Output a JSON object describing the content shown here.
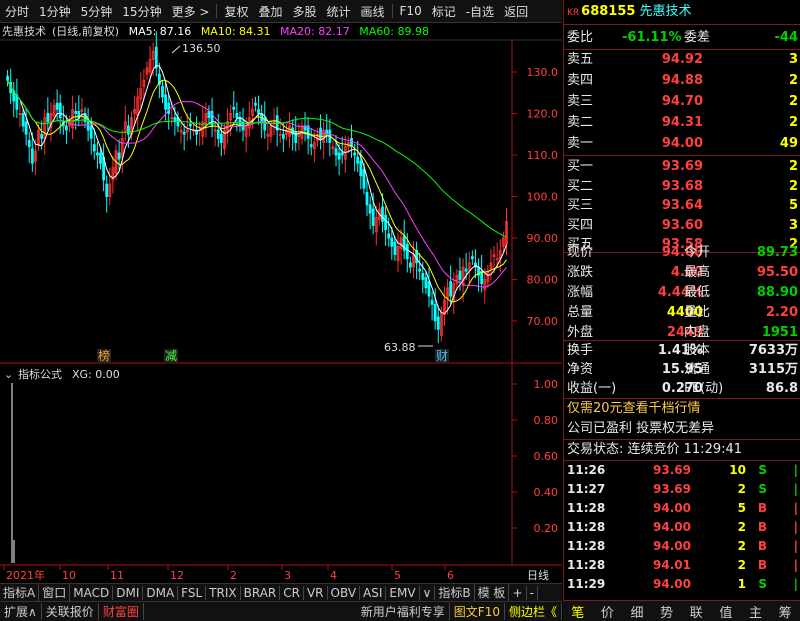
{
  "toolbar": {
    "items": [
      "分时",
      "1分钟",
      "5分钟",
      "15分钟",
      "更多 >",
      "复权",
      "叠加",
      "多股",
      "统计",
      "画线",
      "F10",
      "标记",
      "-自选",
      "返回"
    ]
  },
  "chart_header": {
    "name": "先惠技术",
    "mode": "(日线,前复权)",
    "ma5": "MA5: 87.16",
    "ma10": "MA10: 84.31",
    "ma20": "MA20: 82.17",
    "ma60": "MA60: 89.98"
  },
  "colors": {
    "ma5": "#ffffff",
    "ma10": "#ffff00",
    "ma20": "#ff40ff",
    "ma60": "#00ff00",
    "up": "#ff3030",
    "down": "#00ffff",
    "axis": "#b01010"
  },
  "price_axis": [
    "130.0",
    "120.0",
    "110.0",
    "100.0",
    "90.00",
    "80.00",
    "70.00"
  ],
  "annotations": {
    "high": "136.50",
    "low": "63.88",
    "tag_bang": "榜",
    "tag_jian": "减",
    "tag_cai": "财"
  },
  "indicator": {
    "title": "指标公式",
    "value": "XG: 0.00",
    "axis": [
      "1.00",
      "0.80",
      "0.60",
      "0.40",
      "0.20"
    ]
  },
  "date_axis": [
    "2021年",
    "10",
    "11",
    "12",
    "2",
    "3",
    "4",
    "5",
    "6"
  ],
  "period_label": "日线",
  "tabs_row1": [
    "指标A",
    "窗口",
    "MACD",
    "DMI",
    "DMA",
    "FSL",
    "TRIX",
    "BRAR",
    "CR",
    "VR",
    "OBV",
    "ASI",
    "EMV",
    "∨",
    "指标B",
    "模 板",
    "+",
    "-"
  ],
  "tabs_row2": {
    "left": [
      "扩展∧",
      "关联报价",
      "财富圈"
    ],
    "right": [
      "新用户福利专享",
      "图文F10",
      "侧边栏《"
    ]
  },
  "quote": {
    "code": "688155",
    "name": "先惠技术",
    "wei_bi_label": "委比",
    "wei_bi": "-61.11%",
    "wei_cha_label": "委差",
    "wei_cha": "-44",
    "asks": [
      {
        "label": "卖五",
        "price": "94.92",
        "vol": "3"
      },
      {
        "label": "卖四",
        "price": "94.88",
        "vol": "2"
      },
      {
        "label": "卖三",
        "price": "94.70",
        "vol": "2"
      },
      {
        "label": "卖二",
        "price": "94.31",
        "vol": "2"
      },
      {
        "label": "卖一",
        "price": "94.00",
        "vol": "49"
      }
    ],
    "bids": [
      {
        "label": "买一",
        "price": "93.69",
        "vol": "2"
      },
      {
        "label": "买二",
        "price": "93.68",
        "vol": "2"
      },
      {
        "label": "买三",
        "price": "93.64",
        "vol": "5"
      },
      {
        "label": "买四",
        "price": "93.60",
        "vol": "3"
      },
      {
        "label": "买五",
        "price": "93.58",
        "vol": "2"
      }
    ],
    "stats1": [
      {
        "l1": "现价",
        "v1": "94.00",
        "l2": "今开",
        "v2": "89.73"
      },
      {
        "l1": "涨跌",
        "v1": "4.00",
        "l2": "最高",
        "v2": "95.50"
      },
      {
        "l1": "涨幅",
        "v1": "4.44%",
        "l2": "最低",
        "v2": "88.90"
      },
      {
        "l1": "总量",
        "v1": "4400",
        "l2": "量比",
        "v2": "2.20"
      },
      {
        "l1": "外盘",
        "v1": "2449",
        "l2": "内盘",
        "v2": "1951"
      }
    ],
    "stats2": [
      {
        "l1": "换手",
        "v1": "1.41%",
        "l2": "股本",
        "v2": "7633万"
      },
      {
        "l1": "净资",
        "v1": "15.95",
        "l2": "流通",
        "v2": "3115万"
      },
      {
        "l1": "收益(一)",
        "v1": "0.270",
        "l2": "PE(动)",
        "v2": "86.8"
      }
    ],
    "promo": "仅需20元查看千档行情",
    "info": "公司已盈利 投票权无差异",
    "status": "交易状态: 连续竞价 11:29:41",
    "ticks": [
      {
        "time": "11:26",
        "price": "93.69",
        "vol": "10",
        "side": "S"
      },
      {
        "time": "11:27",
        "price": "93.69",
        "vol": "2",
        "side": "S"
      },
      {
        "time": "11:28",
        "price": "94.00",
        "vol": "5",
        "side": "B"
      },
      {
        "time": "11:28",
        "price": "94.00",
        "vol": "2",
        "side": "B"
      },
      {
        "time": "11:28",
        "price": "94.00",
        "vol": "2",
        "side": "B"
      },
      {
        "time": "11:28",
        "price": "94.01",
        "vol": "2",
        "side": "B"
      },
      {
        "time": "11:29",
        "price": "94.00",
        "vol": "1",
        "side": "S"
      }
    ],
    "bottom_tabs": [
      "笔",
      "价",
      "细",
      "势",
      "联",
      "值",
      "主",
      "筹"
    ]
  }
}
